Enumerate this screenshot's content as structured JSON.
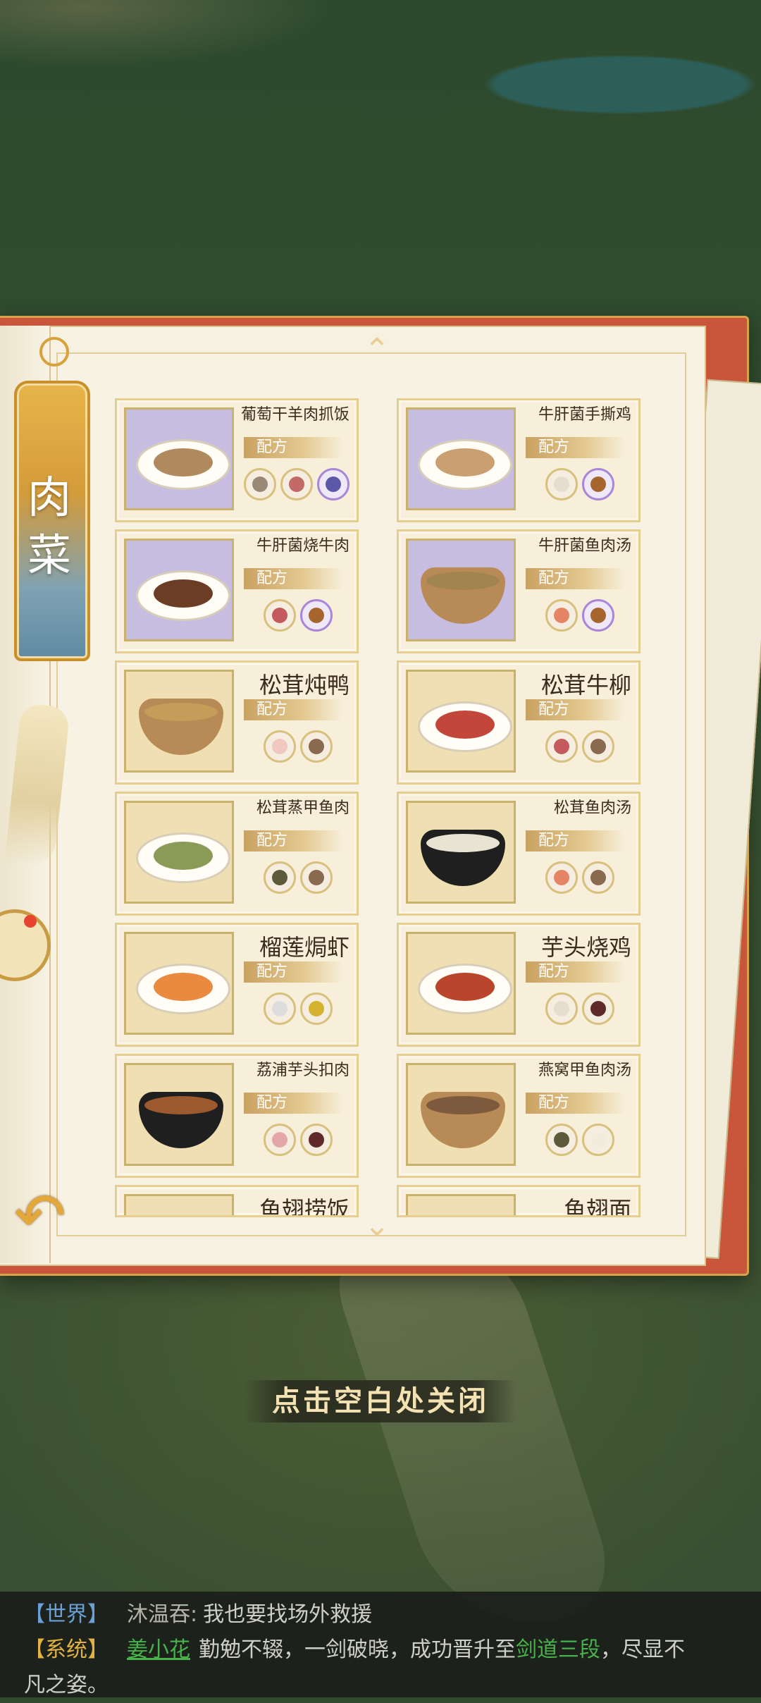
{
  "category": {
    "label_line1": "肉",
    "label_line2": "菜"
  },
  "cards": [
    {
      "title": "葡萄干羊肉抓饭",
      "tag": "配方",
      "thumb": "purple",
      "dish": "rice",
      "ingredients": [
        "mutton",
        "meat",
        "grape"
      ]
    },
    {
      "title": "牛肝菌手撕鸡",
      "tag": "配方",
      "thumb": "purple",
      "dish": "chicken-plate",
      "ingredients": [
        "chicken",
        "mushroom"
      ]
    },
    {
      "title": "牛肝菌烧牛肉",
      "tag": "配方",
      "thumb": "purple",
      "dish": "beef-plate",
      "ingredients": [
        "beef",
        "mushroom"
      ]
    },
    {
      "title": "牛肝菌鱼肉汤",
      "tag": "配方",
      "thumb": "purple",
      "dish": "fish-soup",
      "ingredients": [
        "fish",
        "mushroom"
      ]
    },
    {
      "title": "松茸炖鸭",
      "tag": "配方",
      "thumb": "gold",
      "dish": "duck-stew",
      "ingredients": [
        "duck",
        "matsutake"
      ]
    },
    {
      "title": "松茸牛柳",
      "tag": "配方",
      "thumb": "gold",
      "dish": "beef-fillet",
      "ingredients": [
        "beef",
        "matsutake"
      ]
    },
    {
      "title": "松茸蒸甲鱼肉",
      "tag": "配方",
      "thumb": "gold",
      "dish": "turtle-plate",
      "ingredients": [
        "turtle",
        "matsutake"
      ]
    },
    {
      "title": "松茸鱼肉汤",
      "tag": "配方",
      "thumb": "gold",
      "dish": "fish-bowl",
      "ingredients": [
        "fish",
        "matsutake"
      ]
    },
    {
      "title": "榴莲焗虾",
      "tag": "配方",
      "thumb": "gold",
      "dish": "shrimp",
      "ingredients": [
        "shrimp",
        "durian"
      ]
    },
    {
      "title": "芋头烧鸡",
      "tag": "配方",
      "thumb": "gold",
      "dish": "taro-chicken",
      "ingredients": [
        "chicken",
        "taro"
      ]
    },
    {
      "title": "荔浦芋头扣肉",
      "tag": "配方",
      "thumb": "gold",
      "dish": "pork-pot",
      "ingredients": [
        "pork",
        "taro"
      ]
    },
    {
      "title": "燕窝甲鱼肉汤",
      "tag": "配方",
      "thumb": "gold",
      "dish": "turtle-soup",
      "ingredients": [
        "turtle",
        "birdnest"
      ]
    },
    {
      "title": "鱼翅捞饭",
      "tag": "",
      "thumb": "gold",
      "dish": "",
      "ingredients": []
    },
    {
      "title": "鱼翅面",
      "tag": "",
      "thumb": "gold",
      "dish": "",
      "ingredients": []
    }
  ],
  "close_hint": "点击空白处关闭",
  "chat": {
    "line1": {
      "channel": "【世界】",
      "sender": "沐温吞:",
      "message": "我也要找场外救援"
    },
    "line2": {
      "channel": "【系统】",
      "player": "姜小花",
      "message_a": "勤勉不辍，一剑破晓，成功晋升至",
      "realm": "剑道三段",
      "message_b": "，尽显不"
    },
    "line3": {
      "message": "凡之姿。"
    }
  },
  "colors": {
    "purple_rarity": "#c6bde0",
    "gold_rarity": "#f0dfb2",
    "book_cover": "#c9553a",
    "accent_gold": "#e3a73a"
  }
}
